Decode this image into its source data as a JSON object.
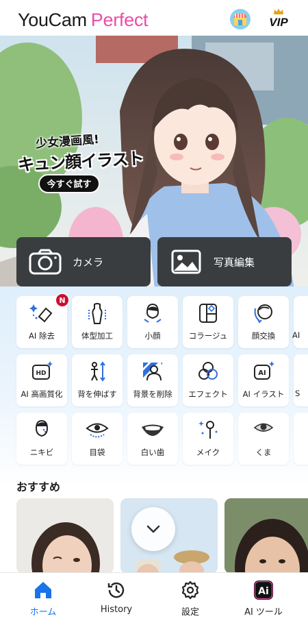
{
  "header": {
    "logo_left": "YouCam",
    "logo_right": "Perfect",
    "vip_label": "VIP",
    "store_icon": "store-icon",
    "crown_icon": "crown-icon"
  },
  "hero": {
    "tag_small": "少女漫画風!",
    "tag_large": "キュン顔イラスト",
    "cta": "今すぐ試す"
  },
  "big_cards": [
    {
      "label": "カメラ",
      "icon": "camera-icon"
    },
    {
      "label": "写真編集",
      "icon": "photo-icon"
    }
  ],
  "features": {
    "row1": [
      {
        "label": "AI 除去",
        "icon": "eraser-icon",
        "badge": "N"
      },
      {
        "label": "体型加工",
        "icon": "body-shape-icon"
      },
      {
        "label": "小顔",
        "icon": "face-slim-icon"
      },
      {
        "label": "コラージュ",
        "icon": "collage-icon"
      },
      {
        "label": "顔交換",
        "icon": "face-swap-icon"
      },
      {
        "label": "AI",
        "icon": "ai-partial-icon"
      }
    ],
    "row2": [
      {
        "label": "AI 高画質化",
        "icon": "hd-icon"
      },
      {
        "label": "背を伸ばす",
        "icon": "height-icon"
      },
      {
        "label": "背景を削除",
        "icon": "remove-bg-icon"
      },
      {
        "label": "エフェクト",
        "icon": "effect-icon"
      },
      {
        "label": "AI イラスト",
        "icon": "ai-illust-icon"
      },
      {
        "label": "S",
        "icon": "partial-icon"
      }
    ],
    "row3": [
      {
        "label": "ニキビ",
        "icon": "acne-icon"
      },
      {
        "label": "目袋",
        "icon": "eye-bag-icon"
      },
      {
        "label": "白い歯",
        "icon": "teeth-icon"
      },
      {
        "label": "メイク",
        "icon": "makeup-icon"
      },
      {
        "label": "くま",
        "icon": "dark-circle-icon"
      },
      {
        "label": "",
        "icon": "partial-icon"
      }
    ]
  },
  "recommend": {
    "title": "おすすめ"
  },
  "nav": [
    {
      "label": "ホーム",
      "icon": "home-icon",
      "active": true
    },
    {
      "label": "History",
      "icon": "history-icon"
    },
    {
      "label": "設定",
      "icon": "gear-icon"
    },
    {
      "label": "AI ツール",
      "icon": "ai-tools-icon"
    }
  ],
  "colors": {
    "accent_pink": "#e84ea8",
    "active_blue": "#1a73e8",
    "card_dark": "#3a3d40",
    "badge_red": "#c8102e"
  }
}
